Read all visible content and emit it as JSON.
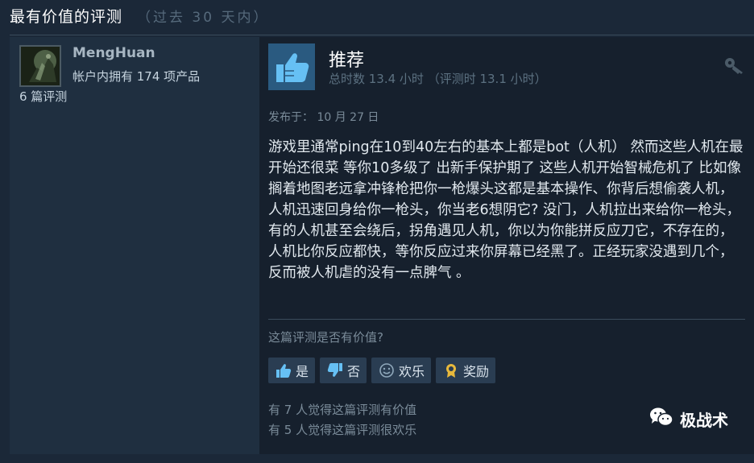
{
  "section": {
    "title": "最有价值的评测",
    "subtitle": "（过去 30 天内）"
  },
  "author": {
    "name": "MengHuan",
    "products": "帐户内拥有 174 项产品",
    "reviews": "6 篇评测",
    "avatar_icon": "avatar-image"
  },
  "review": {
    "recommendation": "推荐",
    "hours": "总时数 13.4 小时 （评测时 13.1 小时）",
    "posted": "发布于：  10 月 27 日",
    "body": "游戏里通常ping在10到40左右的基本上都是bot（人机） 然而这些人机在最开始还很菜 等你10多级了 出新手保护期了 这些人机开始智械危机了 比如像搁着地图老远拿冲锋枪把你一枪爆头这都是基本操作、你背后想偷袭人机，人机迅速回身给你一枪头，你当老6想阴它? 没门，人机拉出来给你一枪头，有的人机甚至会绕后，拐角遇见人机，你以为你能拼反应刀它，不存在的，人机比你反应都快，等你反应过来你屏幕已经黑了。正经玩家没遇到几个，反而被人机虐的没有一点脾气 。",
    "recommend_icon": "thumbs-up-icon",
    "key_icon": "key-icon"
  },
  "helpful": {
    "question": "这篇评测是否有价值?",
    "buttons": [
      {
        "label": "是",
        "icon": "thumbs-up-icon"
      },
      {
        "label": "否",
        "icon": "thumbs-down-icon"
      },
      {
        "label": "欢乐",
        "icon": "smiley-icon"
      },
      {
        "label": "奖励",
        "icon": "award-icon"
      }
    ],
    "stat_helpful": "有 7 人觉得这篇评测有价值",
    "stat_funny": "有 5 人觉得这篇评测很欢乐"
  },
  "watermark": {
    "text": "极战术",
    "icon": "wechat-icon"
  },
  "colors": {
    "background": "#1b2838",
    "accent": "#66c0f4",
    "thumb_box": "#2a5a80"
  }
}
